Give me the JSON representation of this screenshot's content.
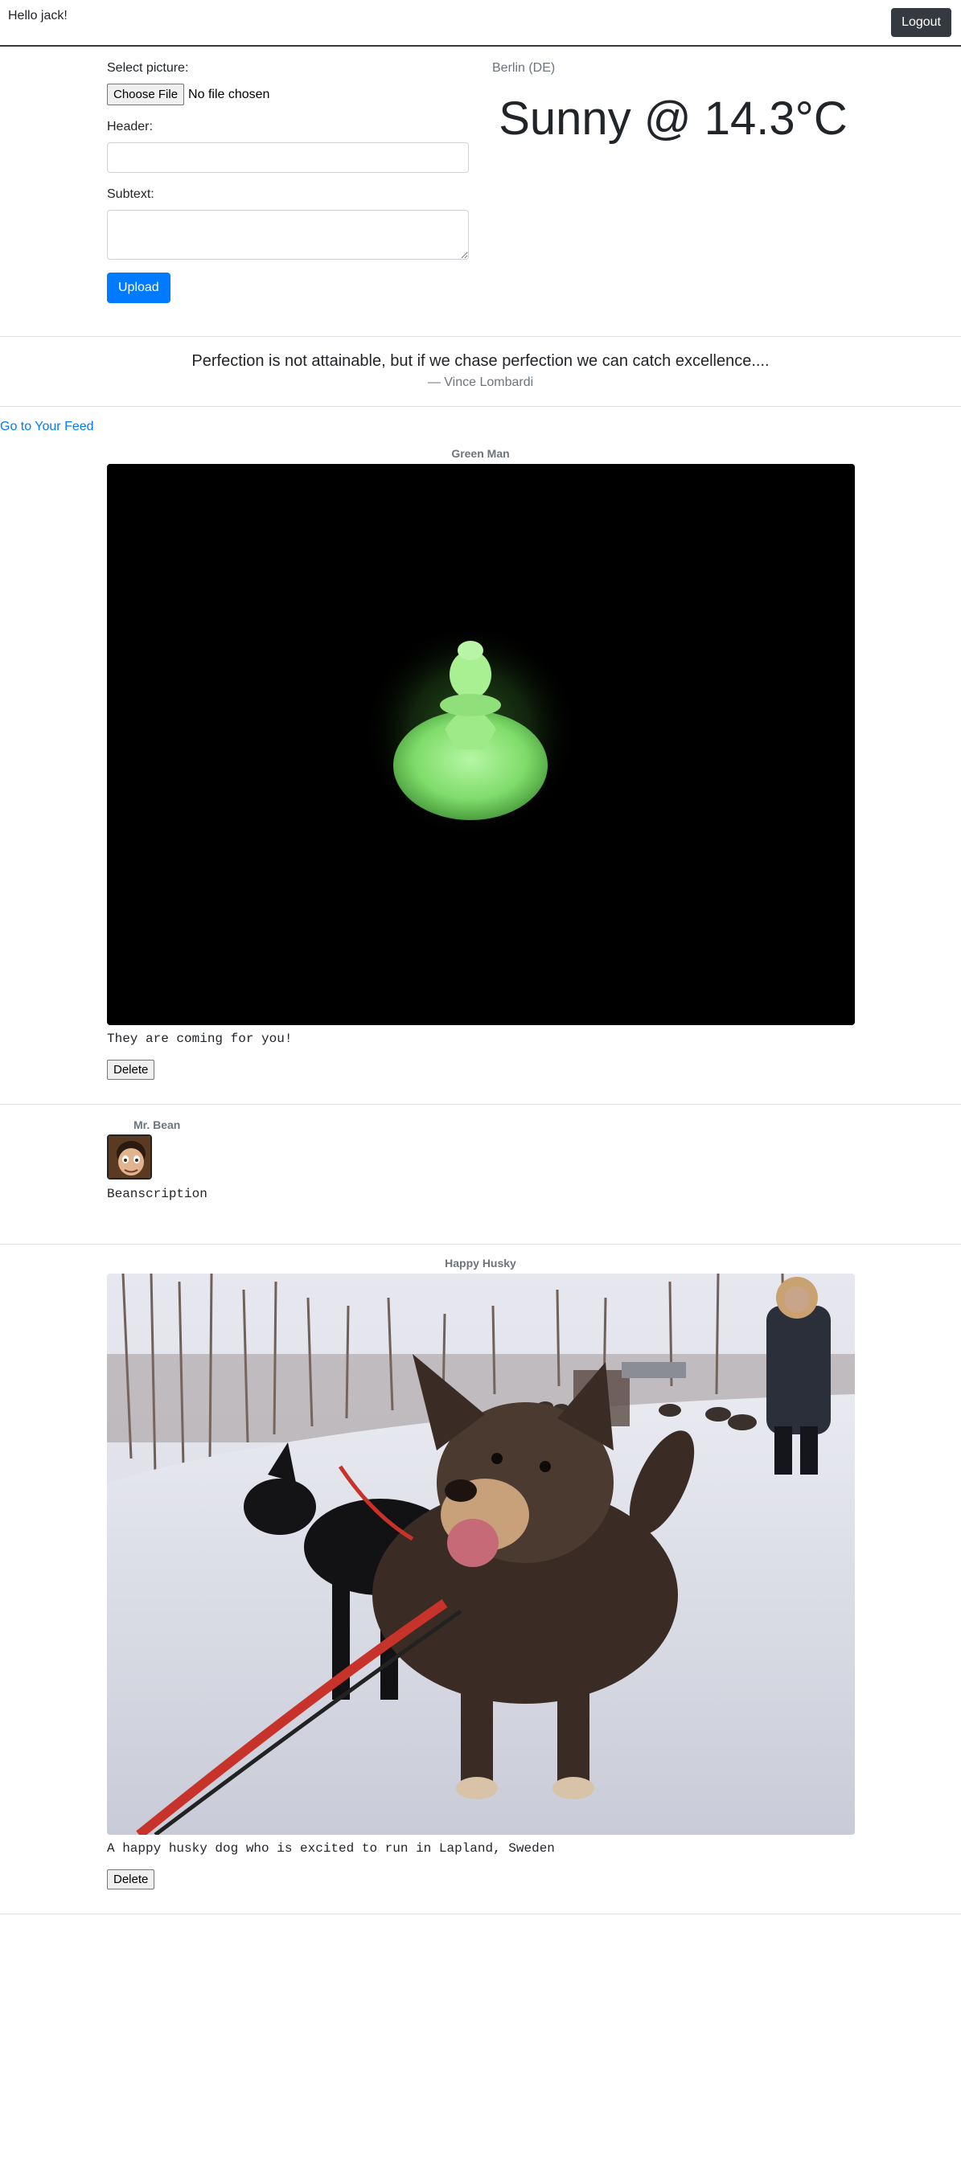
{
  "nav": {
    "greeting": "Hello jack!",
    "logout_label": "Logout"
  },
  "upload_form": {
    "picture_label": "Select picture:",
    "choose_file_label": "Choose File",
    "file_status": "No file chosen",
    "header_label": "Header:",
    "header_value": "",
    "subtext_label": "Subtext:",
    "subtext_value": "",
    "upload_label": "Upload"
  },
  "weather": {
    "city": "Berlin (DE)",
    "summary": "Sunny @ 14.3°C"
  },
  "quote": {
    "text": "Perfection is not attainable, but if we chase perfection we can catch excellence....",
    "author": "— Vince Lombardi"
  },
  "feed_link": "Go to Your Feed",
  "posts": [
    {
      "title": "Green Man",
      "caption": "They are coming for you!",
      "delete_label": "Delete"
    },
    {
      "title": "Mr. Bean",
      "caption": "Beanscription"
    },
    {
      "title": "Happy Husky",
      "caption": "A happy husky dog who is excited to run in Lapland, Sweden",
      "delete_label": "Delete"
    }
  ]
}
